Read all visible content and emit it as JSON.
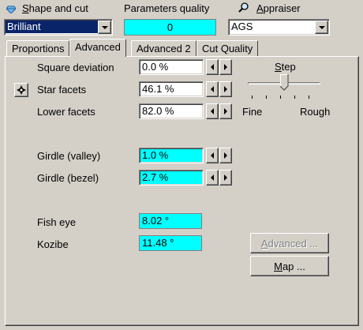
{
  "header": {
    "shape_label": "Shape and cut",
    "shape_value": "Brilliant",
    "quality_label": "Parameters quality",
    "quality_value": "0",
    "appraiser_label": "Appraiser",
    "appraiser_value": "AGS"
  },
  "tabs": [
    {
      "label": "Proportions",
      "active": false
    },
    {
      "label": "Advanced",
      "active": true
    },
    {
      "label": "Advanced 2",
      "active": false
    },
    {
      "label": "Cut Quality",
      "active": false
    }
  ],
  "params": [
    {
      "label": "Square deviation",
      "value": "0.0 %",
      "highlight": false
    },
    {
      "label": "Star facets",
      "value": "46.1 %",
      "highlight": false
    },
    {
      "label": "Lower facets",
      "value": "82.0 %",
      "highlight": false
    },
    {
      "label": "Girdle (valley)",
      "value": "1.0 %",
      "highlight": true
    },
    {
      "label": "Girdle (bezel)",
      "value": "2.7 %",
      "highlight": true
    }
  ],
  "readonly": [
    {
      "label": "Fish eye",
      "value": "8.02 °"
    },
    {
      "label": "Kozibe",
      "value": "11.48 °"
    }
  ],
  "step": {
    "label": "Step",
    "min_label": "Fine",
    "max_label": "Rough",
    "level": 0.5
  },
  "buttons": {
    "advanced": "Advanced ...",
    "map": "Map ..."
  },
  "colors": {
    "background": "#d4d0c8",
    "highlight": "#00ffff",
    "selection": "#0a246a",
    "disabled_text": "#808080"
  },
  "icons": {
    "shape": "diamond-icon",
    "appraiser": "magnifier-icon",
    "star": "star-facets-icon"
  }
}
